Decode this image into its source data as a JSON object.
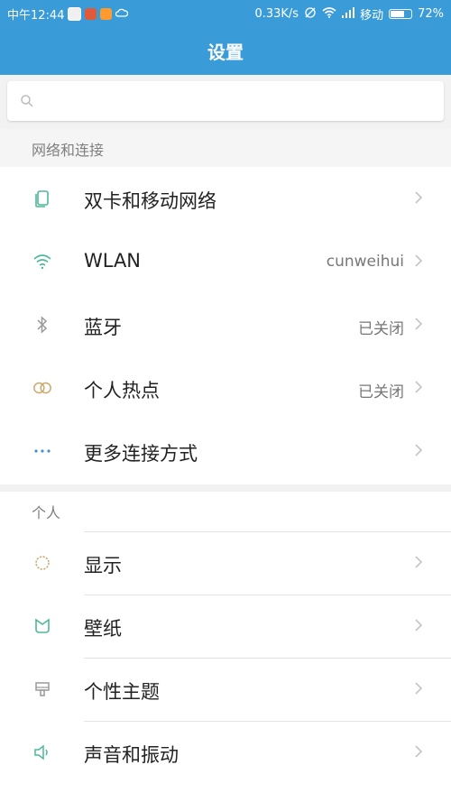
{
  "status_bar": {
    "time": "中午12:44",
    "network_speed": "0.33K/s",
    "carrier": "移动",
    "battery": "72%",
    "battery_level": 0.72
  },
  "header": {
    "title": "设置"
  },
  "search": {
    "placeholder": ""
  },
  "sections": [
    {
      "title": "网络和连接",
      "items": [
        {
          "label": "双卡和移动网络",
          "value": "",
          "icon": "sim-card-icon"
        },
        {
          "label": "WLAN",
          "value": "cunweihui",
          "icon": "wifi-icon"
        },
        {
          "label": "蓝牙",
          "value": "已关闭",
          "icon": "bluetooth-icon"
        },
        {
          "label": "个人热点",
          "value": "已关闭",
          "icon": "hotspot-icon"
        },
        {
          "label": "更多连接方式",
          "value": "",
          "icon": "more-icon"
        }
      ]
    },
    {
      "title": "个人",
      "items": [
        {
          "label": "显示",
          "value": "",
          "icon": "display-icon"
        },
        {
          "label": "壁纸",
          "value": "",
          "icon": "wallpaper-icon"
        },
        {
          "label": "个性主题",
          "value": "",
          "icon": "theme-icon"
        },
        {
          "label": "声音和振动",
          "value": "",
          "icon": "sound-icon"
        }
      ]
    }
  ],
  "colors": {
    "accent": "#3a9bd9",
    "icon_green": "#4fb89a",
    "icon_gold": "#c9a86a"
  }
}
